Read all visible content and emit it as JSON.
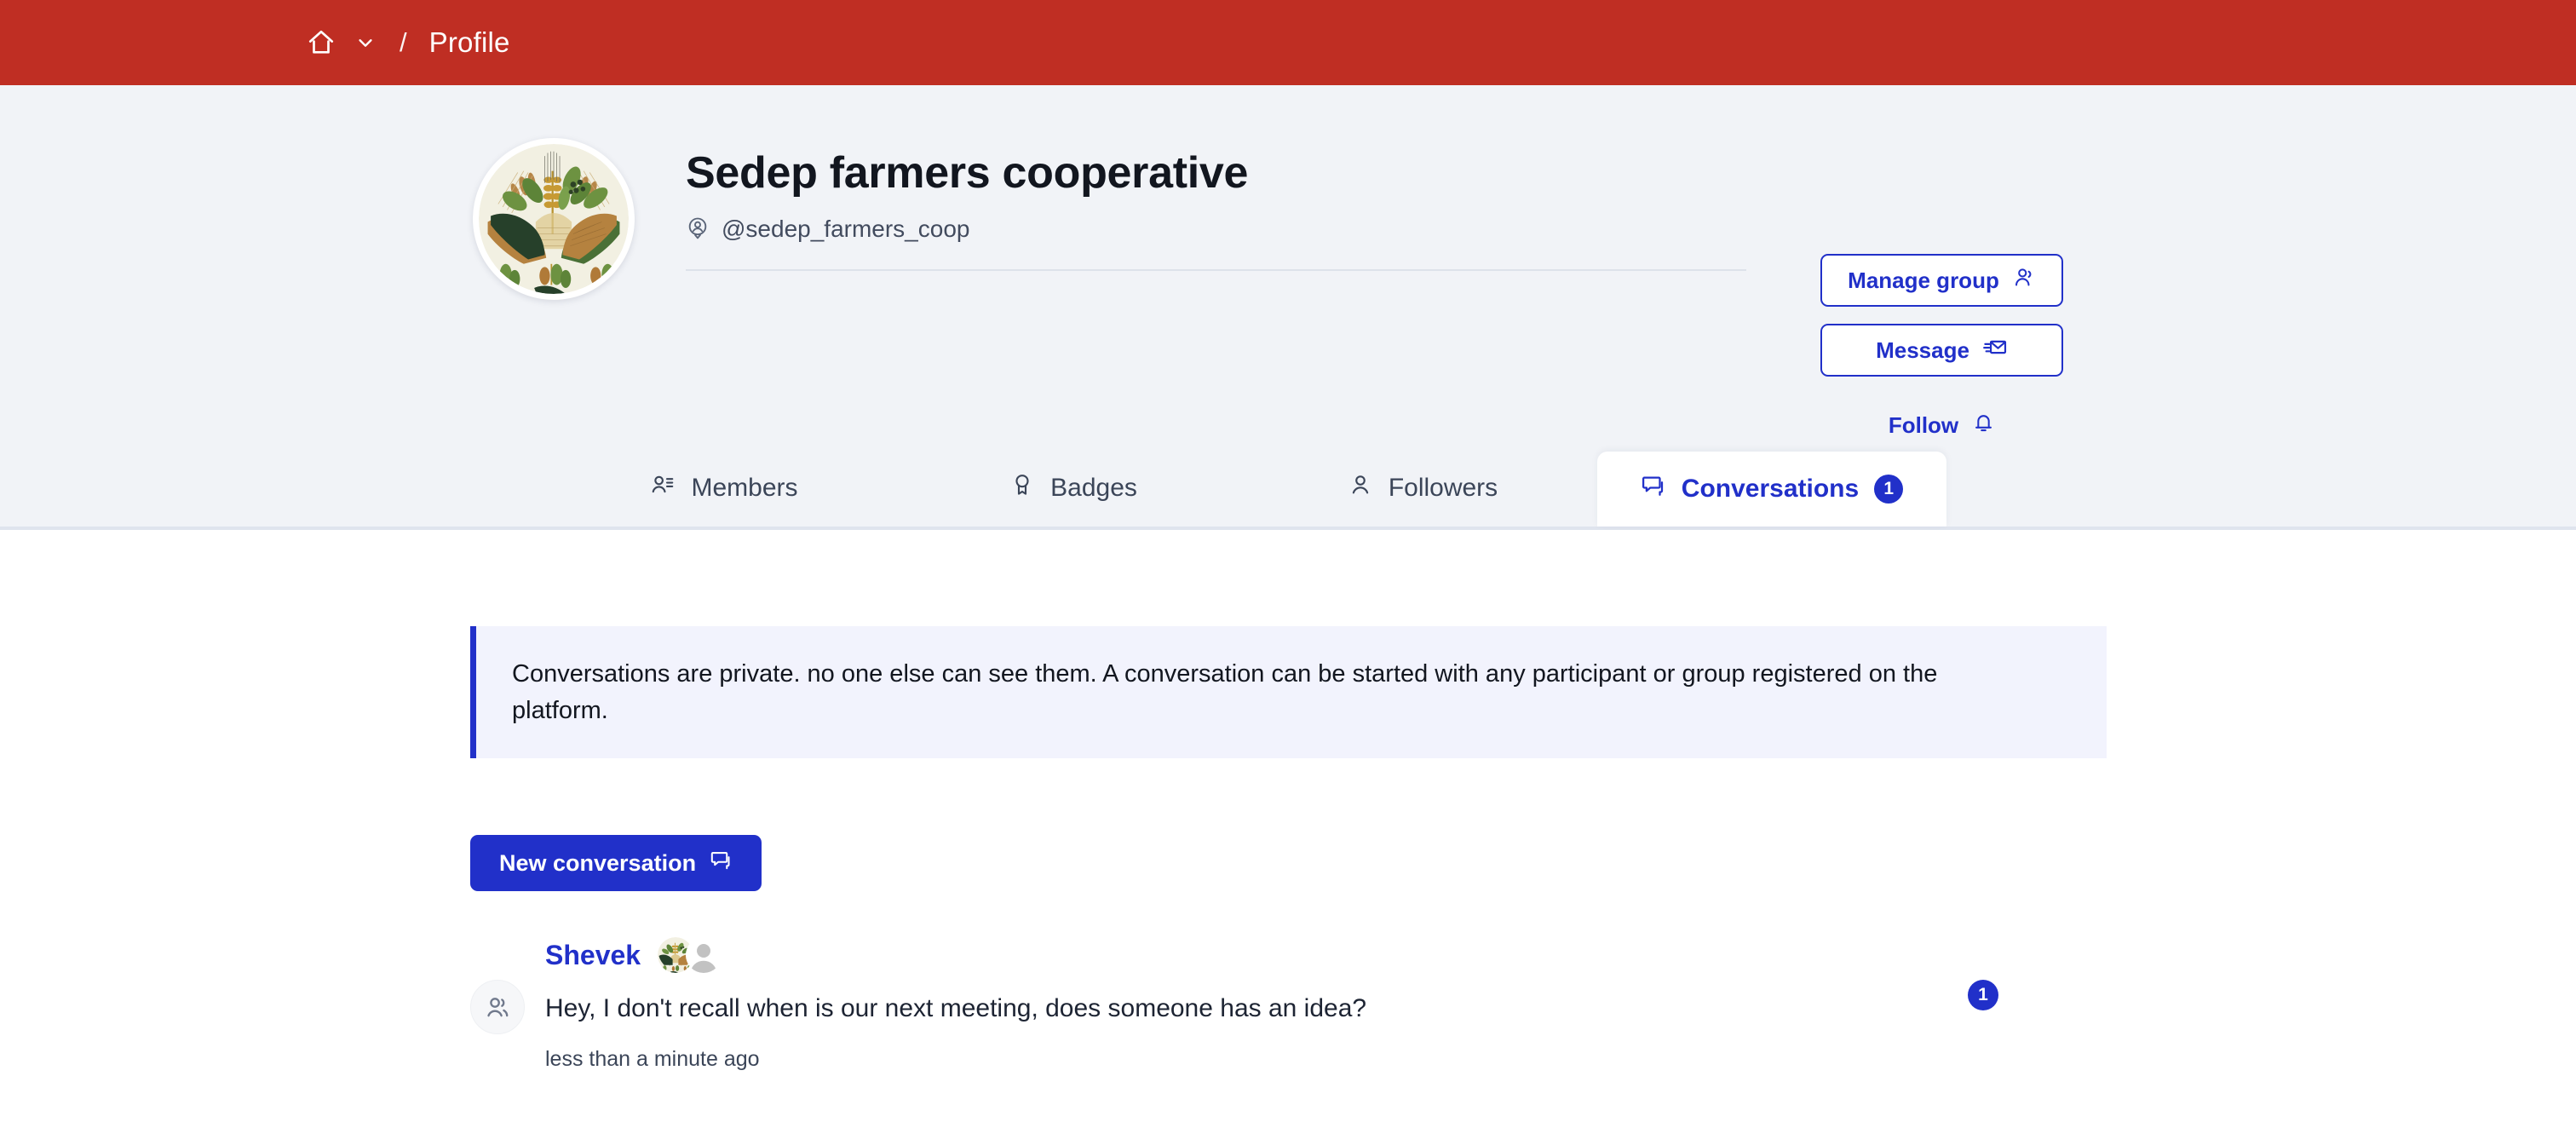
{
  "topbar": {
    "home_icon": "home-icon",
    "chevron_icon": "chevron-down-icon",
    "separator": "/",
    "current": "Profile",
    "background_color": "#bf2e23"
  },
  "profile": {
    "avatar_alt": "sedep-farmers-cooperative-avatar",
    "name": "Sedep farmers cooperative",
    "handle": "@sedep_farmers_coop",
    "handle_icon": "account-pin-icon"
  },
  "actions": {
    "manage_group": {
      "label": "Manage group",
      "icon": "person-add-icon"
    },
    "message": {
      "label": "Message",
      "icon": "send-mail-icon"
    },
    "follow": {
      "label": "Follow",
      "icon": "bell-icon"
    },
    "accent_color": "#2130c9"
  },
  "tabs": [
    {
      "label": "Members",
      "icon": "person-list-icon",
      "active": false,
      "badge": ""
    },
    {
      "label": "Badges",
      "icon": "award-ribbon-icon",
      "active": false,
      "badge": ""
    },
    {
      "label": "Followers",
      "icon": "person-icon",
      "active": false,
      "badge": ""
    },
    {
      "label": "Conversations",
      "icon": "chat-bubble-icon",
      "active": true,
      "badge": "1"
    }
  ],
  "notice": {
    "text": "Conversations are private. no one else can see them. A conversation can be started with any participant or group registered on the platform.",
    "accent_color": "#2130c9",
    "background_color": "#f2f3fd"
  },
  "new_conversation": {
    "label": "New conversation",
    "icon": "chat-bubble-icon"
  },
  "conversations": [
    {
      "group_icon": "group-people-icon",
      "author": "Shevek",
      "participant_avatars": [
        "farm-illustration-avatar",
        "default-person-avatar"
      ],
      "message": "Hey, I don't recall when is our next meeting, does someone has an idea?",
      "timestamp": "less than a minute ago",
      "unread_count": "1"
    }
  ]
}
